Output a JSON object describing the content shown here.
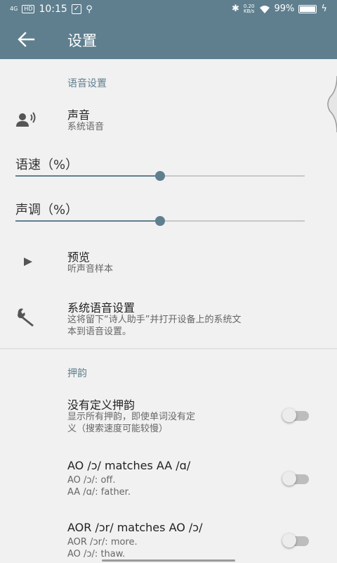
{
  "status_bar": {
    "signal": "4G",
    "hd": "HD",
    "time": "10:15",
    "speed": "0.20",
    "speed_unit": "KB/s",
    "battery": "99%"
  },
  "app_bar": {
    "title": "设置"
  },
  "voice_section": {
    "header": "语音设置",
    "voice": {
      "title": "声音",
      "subtitle": "系统语音"
    },
    "speed": {
      "label": "语速（%）",
      "value": 50
    },
    "pitch": {
      "label": "声调（%）",
      "value": 50
    },
    "preview": {
      "title": "预览",
      "subtitle": "听声音样本"
    },
    "system_settings": {
      "title": "系统语音设置",
      "subtitle_line1": "这将留下“诗人助手”并打开设备上的系统文",
      "subtitle_line2": "本到语音设置。"
    }
  },
  "rhyme_section": {
    "header": "押韵",
    "items": [
      {
        "title": "没有定义押韵",
        "sub1": "显示所有押韵，即使单词没有定",
        "sub2": "义（搜索速度可能较慢）",
        "enabled": false
      },
      {
        "title": "AO /ɔ/ matches AA /ɑ/",
        "sub1": "AO /ɔ/: off.",
        "sub2": "AA /ɑ/: father.",
        "enabled": false
      },
      {
        "title": "AOR /ɔr/ matches AO /ɔ/",
        "sub1": "AOR /ɔr/: more.",
        "sub2": "AO /ɔ/: thaw.",
        "enabled": false
      }
    ]
  },
  "colors": {
    "primary": "#5f7f8f",
    "background": "#f1f1f1",
    "switch_off": "#bdbdbd"
  }
}
